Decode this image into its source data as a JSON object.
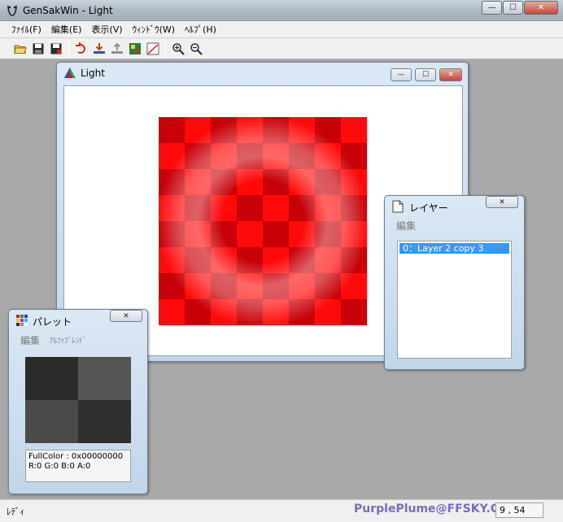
{
  "app": {
    "title": "GenSakWin - Light",
    "menu": [
      "ﾌｧｲﾙ(F)",
      "編集(E)",
      "表示(V)",
      "ｳｨﾝﾄﾞｳ(W)",
      "ﾍﾙﾌﾟ(H)"
    ]
  },
  "caption_buttons": {
    "minimize": "—",
    "maximize": "☐",
    "close": "✕"
  },
  "toolbar": {
    "icons": [
      "open-folder-icon",
      "save-icon",
      "save-as-icon",
      "undo-icon",
      "import-icon",
      "export-icon",
      "layers-grid-icon",
      "graph-icon",
      "zoom-in-icon",
      "zoom-out-icon"
    ]
  },
  "statusbar": {
    "text": "ﾚﾃﾞｨ",
    "credit": "PurplePlume@FFSKY.COM",
    "coords": "9 , 54"
  },
  "image_window": {
    "title": "Light",
    "checker": {
      "grid": 8,
      "dark_color": "#c80008",
      "light_color": "#ff0a0a"
    }
  },
  "layer_window": {
    "title": "レイヤー",
    "menu": [
      "編集"
    ],
    "layers": [
      {
        "label": "0：Layer 2 copy 3",
        "selected": true
      }
    ]
  },
  "palette_window": {
    "title": "パレット",
    "menu": [
      "編集",
      "ｱﾙﾌｧﾌﾞﾚﾝﾄﾞ"
    ],
    "swatches": [
      "#2b2b2b",
      "#555555",
      "#4a4a4a",
      "#2f2f2f"
    ],
    "info_line1": "FullColor : 0x00000000",
    "info_line2": "R:0 G:0 B:0 A:0"
  },
  "colors": {
    "selection": "#3399ff",
    "credit": "#7b68c9",
    "background": "#a9a9a9"
  }
}
